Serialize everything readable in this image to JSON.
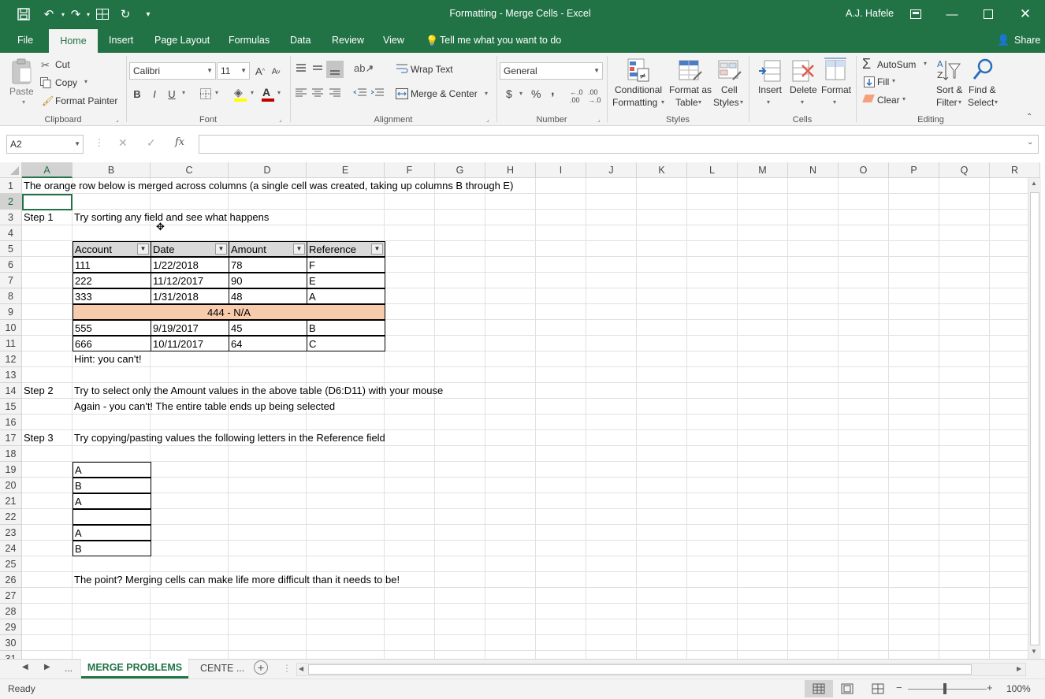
{
  "window": {
    "title": "Formatting - Merge Cells  -  Excel",
    "user": "A.J. Hafele"
  },
  "menu_tabs": [
    "File",
    "Home",
    "Insert",
    "Page Layout",
    "Formulas",
    "Data",
    "Review",
    "View"
  ],
  "tell_me": "Tell me what you want to do",
  "share": "Share",
  "ribbon": {
    "clipboard": {
      "paste": "Paste",
      "cut": "Cut",
      "copy": "Copy",
      "format_painter": "Format Painter",
      "group": "Clipboard"
    },
    "font": {
      "name": "Calibri",
      "size": "11",
      "group": "Font",
      "bold": "B",
      "italic": "I",
      "underline": "U"
    },
    "alignment": {
      "wrap": "Wrap Text",
      "merge": "Merge & Center",
      "group": "Alignment"
    },
    "number": {
      "format": "General",
      "currency": "$",
      "percent": "%",
      "comma": ",",
      "group": "Number"
    },
    "styles": {
      "conditional_1": "Conditional",
      "conditional_2": "Formatting",
      "table_1": "Format as",
      "table_2": "Table",
      "cell_1": "Cell",
      "cell_2": "Styles",
      "group": "Styles"
    },
    "cells": {
      "insert": "Insert",
      "delete": "Delete",
      "format": "Format",
      "group": "Cells"
    },
    "editing": {
      "autosum": "AutoSum",
      "fill": "Fill",
      "clear": "Clear",
      "sort_1": "Sort &",
      "sort_2": "Filter",
      "find_1": "Find &",
      "find_2": "Select",
      "group": "Editing"
    }
  },
  "formula_bar": {
    "name_box": "A2",
    "fx": "fx",
    "value": ""
  },
  "columns": [
    "A",
    "B",
    "C",
    "D",
    "E",
    "F",
    "G",
    "H",
    "I",
    "J",
    "K",
    "L",
    "M",
    "N",
    "O",
    "P",
    "Q",
    "R"
  ],
  "rows": [
    "1",
    "2",
    "3",
    "4",
    "5",
    "6",
    "7",
    "8",
    "9",
    "10",
    "11",
    "12",
    "13",
    "14",
    "15",
    "16",
    "17",
    "18",
    "19",
    "20",
    "21",
    "22",
    "23",
    "24",
    "25",
    "26",
    "27",
    "28",
    "29",
    "30",
    "31"
  ],
  "cells": {
    "a1": "The orange row below is merged across columns (a single cell was created, taking up columns B through E)",
    "a3": "Step 1",
    "b3": "Try sorting any field and see what happens",
    "b12": "Hint: you can't!",
    "a14": "Step 2",
    "b14": "Try to select only the Amount values in the above table (D6:D11) with your mouse",
    "b15": "Again - you can't!  The entire table ends up being selected",
    "a17": "Step 3",
    "b17": "Try copying/pasting values the following letters in the Reference field",
    "b26": "The point?  Merging cells can make life more difficult than it needs to be!"
  },
  "table": {
    "headers": [
      "Account",
      "Date",
      "Amount",
      "Reference"
    ],
    "rows": [
      [
        "111",
        "1/22/2018",
        "78",
        "F"
      ],
      [
        "222",
        "11/12/2017",
        "90",
        "E"
      ],
      [
        "333",
        "1/31/2018",
        "48",
        "A"
      ],
      [
        "555",
        "9/19/2017",
        "45",
        "B"
      ],
      [
        "666",
        "10/11/2017",
        "64",
        "C"
      ]
    ],
    "merged_row": "444 - N/A",
    "merged_color": "#f8cbad"
  },
  "letters": [
    "A",
    "B",
    "A",
    "",
    "A",
    "B"
  ],
  "sheets": {
    "active": "MERGE PROBLEMS",
    "other": "CENTE ...",
    "ellipsis": "..."
  },
  "status": {
    "ready": "Ready",
    "zoom": "100%"
  },
  "colors": {
    "excel_green": "#217346",
    "ribbon_bg": "#f3f3f3"
  }
}
